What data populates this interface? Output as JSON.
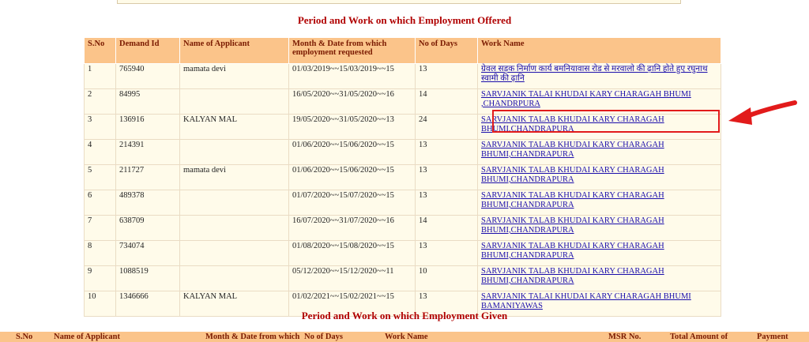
{
  "section_offered_title": "Period and Work on which Employment Offered",
  "section_given_title": "Period and Work on which Employment Given",
  "offered_table": {
    "headers": [
      "S.No",
      "Demand Id",
      "Name of Applicant",
      "Month & Date from which employment requested",
      "No of Days",
      "Work Name"
    ],
    "rows": [
      {
        "sno": "1",
        "demand_id": "765940",
        "name": "mamata devi",
        "period": "01/03/2019~~15/03/2019~~15",
        "days": "13",
        "work": "ग्रेवल सड़क निर्माण कार्य बमनियावास रोड से मरवालो की ढ़ानि होते हुए रघुनाथ स्वामी की ढ़ानि"
      },
      {
        "sno": "2",
        "demand_id": "84995",
        "name": "",
        "period": "16/05/2020~~31/05/2020~~16",
        "days": "14",
        "work": "SARVJANIK TALAI KHUDAI KARY CHARAGAH BHUMI ,CHANDRPURA"
      },
      {
        "sno": "3",
        "demand_id": "136916",
        "name": "KALYAN MAL",
        "period": "19/05/2020~~31/05/2020~~13",
        "days": "24",
        "work": "SARVJANIK TALAB KHUDAI KARY CHARAGAH BHUMI,CHANDRAPURA"
      },
      {
        "sno": "4",
        "demand_id": "214391",
        "name": "",
        "period": "01/06/2020~~15/06/2020~~15",
        "days": "13",
        "work": "SARVJANIK TALAB KHUDAI KARY CHARAGAH BHUMI,CHANDRAPURA"
      },
      {
        "sno": "5",
        "demand_id": "211727",
        "name": "mamata devi",
        "period": "01/06/2020~~15/06/2020~~15",
        "days": "13",
        "work": "SARVJANIK TALAB KHUDAI KARY CHARAGAH BHUMI,CHANDRAPURA"
      },
      {
        "sno": "6",
        "demand_id": "489378",
        "name": "",
        "period": "01/07/2020~~15/07/2020~~15",
        "days": "13",
        "work": "SARVJANIK TALAB KHUDAI KARY CHARAGAH BHUMI,CHANDRAPURA"
      },
      {
        "sno": "7",
        "demand_id": "638709",
        "name": "",
        "period": "16/07/2020~~31/07/2020~~16",
        "days": "14",
        "work": "SARVJANIK TALAB KHUDAI KARY CHARAGAH BHUMI,CHANDRAPURA"
      },
      {
        "sno": "8",
        "demand_id": "734074",
        "name": "",
        "period": "01/08/2020~~15/08/2020~~15",
        "days": "13",
        "work": "SARVJANIK TALAB KHUDAI KARY CHARAGAH BHUMI,CHANDRAPURA"
      },
      {
        "sno": "9",
        "demand_id": "1088519",
        "name": "",
        "period": "05/12/2020~~15/12/2020~~11",
        "days": "10",
        "work": "SARVJANIK TALAB KHUDAI KARY CHARAGAH BHUMI,CHANDRAPURA"
      },
      {
        "sno": "10",
        "demand_id": "1346666",
        "name": "KALYAN MAL",
        "period": "01/02/2021~~15/02/2021~~15",
        "days": "13",
        "work": "SARVJANIK TALAI KHUDAI KARY CHARAGAH BHUMI BAMANIYAWAS"
      }
    ]
  },
  "given_table": {
    "headers": [
      "S.No",
      "Name of Applicant",
      "Month & Date from which",
      "No of Days",
      "Work Name",
      "MSR No.",
      "Total Amount of",
      "Payment"
    ]
  },
  "colors": {
    "header_bg": "#fbc48a",
    "title_red": "#b00000",
    "link_blue": "#1a0dab",
    "highlight_red": "#e21b1b"
  }
}
